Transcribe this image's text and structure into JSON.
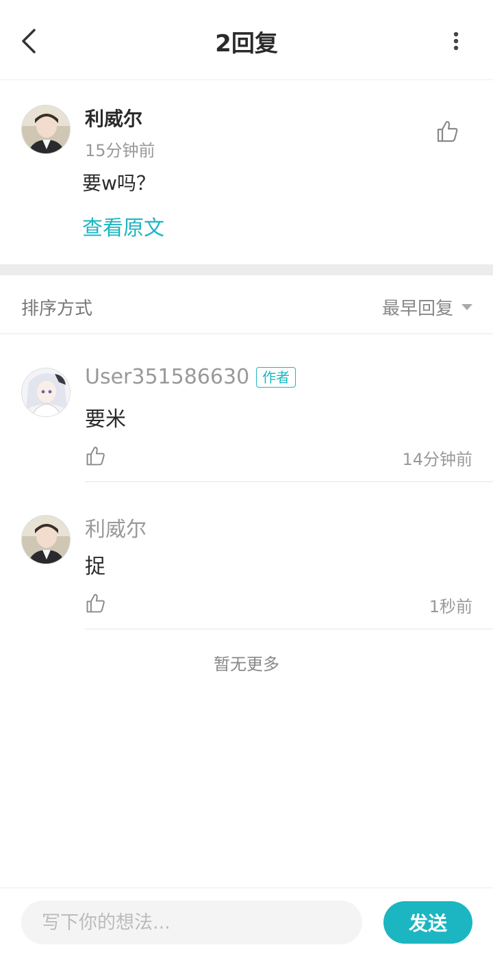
{
  "header": {
    "title": "2回复",
    "back_icon": "chevron-left-icon",
    "more_icon": "more-vertical-icon"
  },
  "original_post": {
    "author": "利威尔",
    "time": "15分钟前",
    "text": "要w吗？",
    "view_original_label": "查看原文",
    "like_icon": "thumbs-up-icon"
  },
  "sort": {
    "label": "排序方式",
    "selected": "最早回复"
  },
  "replies": [
    {
      "author": "User351586630",
      "badge": "作者",
      "text": "要米",
      "time": "14分钟前"
    },
    {
      "author": "利威尔",
      "text": "捉",
      "time": "1秒前"
    }
  ],
  "footer_note": "暂无更多",
  "composer": {
    "placeholder": "写下你的想法...",
    "send_label": "发送"
  },
  "colors": {
    "accent": "#1bb6c1",
    "muted_text": "#999999",
    "divider": "#ececec"
  }
}
